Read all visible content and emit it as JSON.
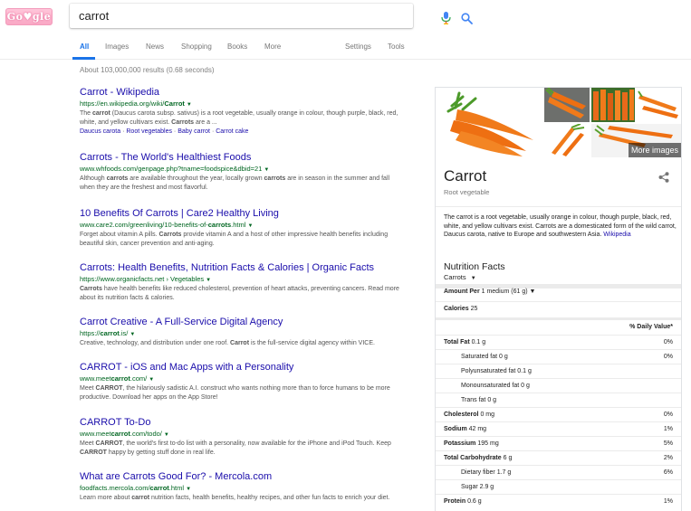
{
  "header": {
    "logo_text": "Go♥gle",
    "search_value": "carrot",
    "mic_icon": "mic-icon",
    "search_icon": "search-icon"
  },
  "tabs": {
    "all": "All",
    "images": "Images",
    "news": "News",
    "shopping": "Shopping",
    "books": "Books",
    "more": "More",
    "settings": "Settings",
    "tools": "Tools"
  },
  "stats": "About 103,000,000 results (0.68 seconds)",
  "results": [
    {
      "title": "Carrot - Wikipedia",
      "url_pre": "https://en.wikipedia.org/wiki/",
      "url_bold": "Carrot",
      "url_post": "",
      "snippet_parts": [
        "The ",
        "carrot",
        " (Daucus carota subsp. sativus) is a root vegetable, usually orange in colour, though purple, black, red, white, and yellow cultivars exist. ",
        "Carrots",
        " are a ..."
      ],
      "links": [
        "Daucus carota",
        "Root vegetables",
        "Baby carrot",
        "Carrot cake"
      ]
    },
    {
      "title": "Carrots - The World's Healthiest Foods",
      "url_pre": "www.whfoods.com/genpage.php?tname=foodspice&dbid=21",
      "url_bold": "",
      "url_post": "",
      "snippet_parts": [
        "Although ",
        "carrots",
        " are available throughout the year, locally grown ",
        "carrots",
        " are in season in the summer and fall when they are the freshest and most flavorful."
      ]
    },
    {
      "title": "10 Benefits Of Carrots | Care2 Healthy Living",
      "url_pre": "www.care2.com/greenliving/10-benefits-of-",
      "url_bold": "carrots",
      "url_post": ".html",
      "snippet_parts": [
        "Forget about vitamin A pills. ",
        "Carrots",
        " provide vitamin A and a host of other impressive health benefits including beautiful skin, cancer prevention and anti-aging."
      ]
    },
    {
      "title": "Carrots: Health Benefits, Nutrition Facts & Calories | Organic Facts",
      "url_pre": "https://www.organicfacts.net › Vegetables",
      "url_bold": "",
      "url_post": "",
      "snippet_parts": [
        "",
        "Carrots",
        " have health benefits like reduced cholesterol, prevention of heart attacks, preventing cancers. Read more about its nutrition facts & calories."
      ]
    },
    {
      "title": "Carrot Creative - A Full-Service Digital Agency",
      "url_pre": "https://",
      "url_bold": "carrot",
      "url_post": ".is/",
      "snippet_parts": [
        "Creative, technology, and distribution under one roof. ",
        "Carrot",
        " is the full-service digital agency within VICE."
      ]
    },
    {
      "title": "CARROT - iOS and Mac Apps with a Personality",
      "url_pre": "www.meet",
      "url_bold": "carrot",
      "url_post": ".com/",
      "snippet_parts": [
        "Meet ",
        "CARROT",
        ", the hilariously sadistic A.I. construct who wants nothing more than to force humans to be more productive. Download her apps on the App Store!"
      ]
    },
    {
      "title": "CARROT To-Do",
      "url_pre": "www.meet",
      "url_bold": "carrot",
      "url_post": ".com/todo/",
      "snippet_parts": [
        "Meet ",
        "CARROT",
        ", the world's first to-do list with a personality, now available for the iPhone and iPod Touch. Keep ",
        "CARROT",
        " happy by getting stuff done in real life."
      ]
    },
    {
      "title": "What are Carrots Good For? - Mercola.com",
      "url_pre": "foodfacts.mercola.com/",
      "url_bold": "carrot",
      "url_post": ".html",
      "snippet_parts": [
        "Learn more about ",
        "carrot",
        " nutrition facts, health benefits, healthy recipes, and other fun facts to enrich your diet."
      ]
    }
  ],
  "panel": {
    "more_images": "More images",
    "title": "Carrot",
    "subtitle": "Root vegetable",
    "share_icon": "share-icon",
    "description": "The carrot is a root vegetable, usually orange in colour, though purple, black, red, white, and yellow cultivars exist. Carrots are a domesticated form of the wild carrot, Daucus carota, native to Europe and southwestern Asia.",
    "wiki_link": "Wikipedia",
    "nutrition_title": "Nutrition Facts",
    "nutrition_subject": "Carrots",
    "amount_label": "Amount Per",
    "amount_value": "1 medium (61 g)",
    "calories_label": "Calories",
    "calories_value": "25",
    "daily_value_header": "% Daily Value*",
    "rows": [
      {
        "label": "Total Fat",
        "value": "0.1 g",
        "pct": "0%",
        "bold": true,
        "sub": false
      },
      {
        "label": "Saturated fat",
        "value": "0 g",
        "pct": "0%",
        "bold": false,
        "sub": true
      },
      {
        "label": "Polyunsaturated fat",
        "value": "0.1 g",
        "pct": "",
        "bold": false,
        "sub": true
      },
      {
        "label": "Monounsaturated fat",
        "value": "0 g",
        "pct": "",
        "bold": false,
        "sub": true
      },
      {
        "label": "Trans fat",
        "value": "0 g",
        "pct": "",
        "bold": false,
        "sub": true
      },
      {
        "label": "Cholesterol",
        "value": "0 mg",
        "pct": "0%",
        "bold": true,
        "sub": false
      },
      {
        "label": "Sodium",
        "value": "42 mg",
        "pct": "1%",
        "bold": true,
        "sub": false
      },
      {
        "label": "Potassium",
        "value": "195 mg",
        "pct": "5%",
        "bold": true,
        "sub": false
      },
      {
        "label": "Total Carbohydrate",
        "value": "6 g",
        "pct": "2%",
        "bold": true,
        "sub": false
      },
      {
        "label": "Dietary fiber",
        "value": "1.7 g",
        "pct": "6%",
        "bold": false,
        "sub": true
      },
      {
        "label": "Sugar",
        "value": "2.9 g",
        "pct": "",
        "bold": false,
        "sub": true
      },
      {
        "label": "Protein",
        "value": "0.6 g",
        "pct": "1%",
        "bold": true,
        "sub": false
      }
    ]
  },
  "colors": {
    "link": "#1a0dab",
    "url": "#006621",
    "accent": "#1a73e8",
    "snippet": "#545454"
  }
}
